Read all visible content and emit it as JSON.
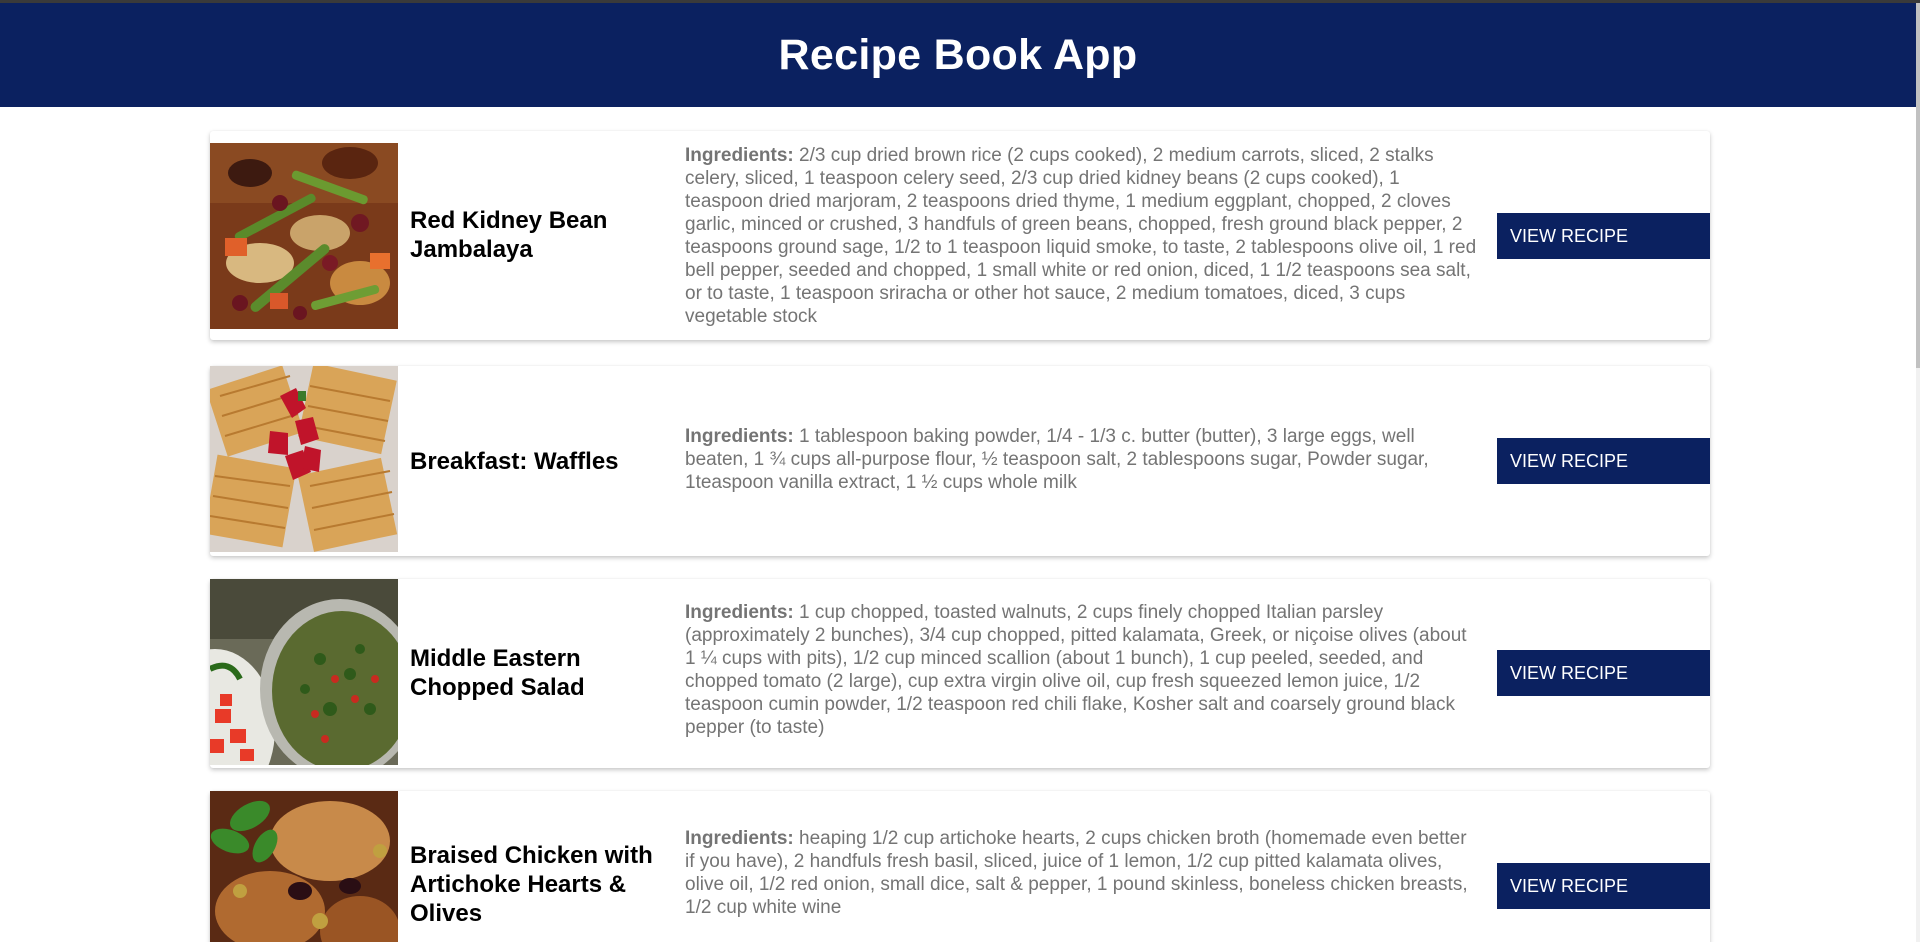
{
  "app": {
    "title": "Recipe Book App"
  },
  "recipes": [
    {
      "title": "Red Kidney Bean Jambalaya",
      "ingredients_label": "Ingredients:",
      "ingredients": "2/3 cup dried brown rice (2 cups cooked), 2 medium carrots, sliced, 2 stalks celery, sliced, 1 teaspoon celery seed, 2/3 cup dried kidney beans (2 cups cooked), 1 teaspoon dried marjoram, 2 teaspoons dried thyme, 1 medium eggplant, chopped, 2 cloves garlic, minced or crushed, 3 handfuls of green beans, chopped, fresh ground black pepper, 2 teaspoons ground sage, 1/2 to 1 teaspoon liquid smoke, to taste, 2 tablespoons olive oil, 1 red bell pepper, seeded and chopped, 1 small white or red onion, diced, 1 1/2 teaspoons sea salt, or to taste, 1 teaspoon sriracha or other hot sauce, 2 medium tomatoes, diced, 3 cups vegetable stock",
      "button_label": "VIEW RECIPE",
      "image": "jambalaya-photo"
    },
    {
      "title": "Breakfast: Waffles",
      "ingredients_label": "Ingredients:",
      "ingredients": "1 tablespoon baking powder, 1/4 - 1/3 c. butter (butter), 3 large eggs, well beaten, 1 ¾ cups all-purpose flour, ½ teaspoon salt, 2 tablespoons sugar, Powder sugar, 1teaspoon vanilla extract, 1 ½ cups whole milk",
      "button_label": "VIEW RECIPE",
      "image": "waffles-photo"
    },
    {
      "title": "Middle Eastern Chopped Salad",
      "ingredients_label": "Ingredients:",
      "ingredients": "1 cup chopped, toasted walnuts, 2 cups finely chopped Italian parsley (approximately 2 bunches), 3/4 cup chopped, pitted kalamata, Greek, or niçoise olives (about 1 ¼ cups with pits), 1/2 cup minced scallion (about 1 bunch), 1 cup peeled, seeded, and chopped tomato (2 large), cup extra virgin olive oil, cup fresh squeezed lemon juice, 1/2 teaspoon cumin powder, 1/2 teaspoon red chili flake, Kosher salt and coarsely ground black pepper (to taste)",
      "button_label": "VIEW RECIPE",
      "image": "salad-photo"
    },
    {
      "title": "Braised Chicken with Artichoke Hearts & Olives",
      "ingredients_label": "Ingredients:",
      "ingredients": "heaping 1/2 cup artichoke hearts, 2 cups chicken broth (homemade even better if you have), 2 handfuls fresh basil, sliced, juice of 1 lemon, 1/2 cup pitted kalamata olives, olive oil, 1/2 red onion, small dice, salt & pepper, 1 pound skinless, boneless chicken breasts, 1/2 cup white wine",
      "button_label": "VIEW RECIPE",
      "image": "chicken-photo"
    }
  ],
  "colors": {
    "header_bg": "#0b2160",
    "button_bg": "#0b2160",
    "ingredients_text": "#747474"
  }
}
